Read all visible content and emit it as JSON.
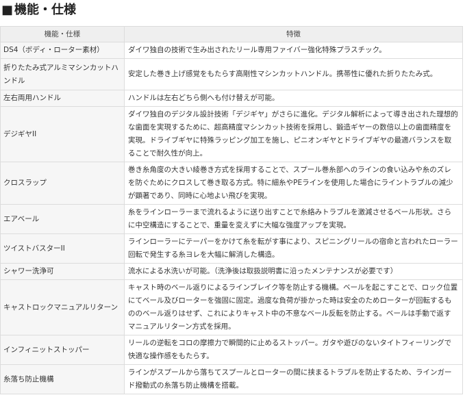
{
  "section": {
    "mark": "■",
    "title": "機能・仕様"
  },
  "table": {
    "headers": {
      "feature": "機能・仕様",
      "detail": "特徴"
    },
    "rows": [
      {
        "feature": "DS4（ボディ・ローター素材）",
        "detail": "ダイワ独自の技術で生み出されたリール専用ファイバー強化特殊プラスチック。"
      },
      {
        "feature": "折りたたみ式アルミマシンカットハンドル",
        "detail": "安定した巻き上げ感覚をもたらす高剛性マシンカットハンドル。携帯性に優れた折りたたみ式。"
      },
      {
        "feature": "左右両用ハンドル",
        "detail": "ハンドルは左右どちら側へも付け替えが可能。"
      },
      {
        "feature": "デジギヤII",
        "detail": "ダイワ独自のデジタル設計技術「デジギヤ」がさらに進化。デジタル解析によって導き出された理想的な歯面を実現するために、超高精度マシンカット技術を採用し、鍛造ギヤーの数倍以上の歯面精度を実現。ドライブギヤに特殊ラッピング加工を施し、ピニオンギヤとドライブギヤの最適バランスを取ることで耐久性が向上。"
      },
      {
        "feature": "クロスラップ",
        "detail": "巻き糸角度の大きい綾巻き方式を採用することで、スプール巻糸部へのラインの食い込みや糸のズレを防ぐためにクロスして巻き取る方式。特に細糸やPEラインを使用した場合にライントラブルの減少が顕著であり、同時に心地よい飛びを実現。"
      },
      {
        "feature": "エアベール",
        "detail": "糸をラインローラーまで流れるように送り出すことで糸絡みトラブルを激減させるベール形状。さらに中空構造にすることで、重量を変えずに大幅な強度アップを実現。"
      },
      {
        "feature": "ツイストバスターII",
        "detail": "ラインローラーにテーパーをかけて糸を転がす事により、スピニングリールの宿命と言われたローラー回転で発生する糸ヨレを大幅に解消した構造。"
      },
      {
        "feature": "シャワー洗浄可",
        "detail": "流水による水洗いが可能。（洗浄後は取扱説明書に沿ったメンテナンスが必要です）"
      },
      {
        "feature": "キャストロックマニュアルリターン",
        "detail": "キャスト時のベール返りによるラインブレイク等を防止する機構。ベールを起こすことで、ロック位置にてベール及びローターを強固に固定。過度な負荷が掛かった時は安全のためローターが回転するもののベール返りはせず、これによりキャスト中の不意なベール反転を防止する。ベールは手動で返すマニュアルリターン方式を採用。"
      },
      {
        "feature": "インフィニットストッパー",
        "detail": "リールの逆転をコロの摩擦力で瞬間的に止めるストッパー。ガタや遊びのないタイトフィーリングで快適な操作感をもたらす。"
      },
      {
        "feature": "糸落ち防止機構",
        "detail": "ラインがスプールから落ちてスプールとローターの間に挟まるトラブルを防止するため、ラインガード撥動式の糸落ち防止機構を搭載。"
      }
    ]
  }
}
